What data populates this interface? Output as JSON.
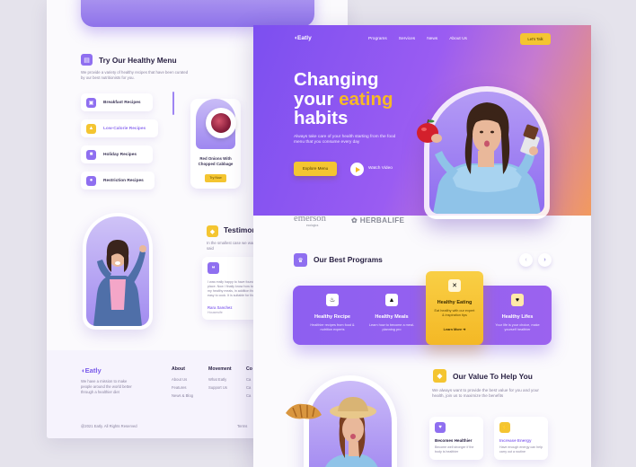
{
  "back_page": {
    "section": {
      "title": "Try Our Healthy Menu",
      "desc": "We provide a variety of healthy recipes that have been curated by our best nutritionists for you."
    },
    "menu": [
      {
        "label": "Breakfast Recipes",
        "icon": "bread-icon"
      },
      {
        "label": "Low-Calorie Recipes",
        "icon": "scale-icon"
      },
      {
        "label": "Holiday Recipes",
        "icon": "gift-icon"
      },
      {
        "label": "Restriction Recipes",
        "icon": "lock-icon"
      }
    ],
    "food_card": {
      "name": "Red Onions With Chopped Cabbage",
      "button": "Try Now"
    },
    "testimonial": {
      "title": "Testimonial",
      "desc": "In the smallest case we want to show what other users have said",
      "text": "I was really happy to have found this place. Now I finally know how to choose my healthy meals, in addition they are easy to cook. It is suitable for the family.",
      "name": "Rara Sanchez",
      "role": "Housewife"
    },
    "footer": {
      "logo": "Eatly",
      "desc": "We have a mission to make people around the world better through a healthier diet",
      "columns": [
        {
          "heading": "About",
          "links": [
            "About Us",
            "Features",
            "News & Blog"
          ]
        },
        {
          "heading": "Movement",
          "links": [
            "What Eatly",
            "Support Us"
          ]
        },
        {
          "heading": "Co",
          "links": [
            "Ca",
            "Ca",
            "Ca"
          ]
        }
      ],
      "copyright": "@2021 Eatly. All Rights Reserved",
      "terms": "Terms"
    }
  },
  "front_page": {
    "nav": {
      "logo": "Eatly",
      "links": [
        "Programs",
        "Services",
        "News",
        "About Us"
      ],
      "cta": "Let's Talk"
    },
    "hero": {
      "title_l1": "Changing",
      "title_l2a": "your ",
      "title_l2b": "eating",
      "title_l3": "habits",
      "desc": "Always take care of your health starting from the food menu that you consume every day",
      "primary_button": "Explore Menu",
      "secondary_button": "Watch Video"
    },
    "partners": {
      "p1": "emerson",
      "p1_sub": "ecologics",
      "p2": "HERBALIFE"
    },
    "programs": {
      "title": "Our Best Programs",
      "items": [
        {
          "title": "Healthy Recipe",
          "desc": "Healthier recipes from food & nutrition experts",
          "icon": "chef-hat-icon"
        },
        {
          "title": "Healthy Meals",
          "desc": "Learn how to become a meal-planning pro",
          "icon": "meal-icon"
        },
        {
          "title": "Healthy Eating",
          "desc": "Eat healthy with our expert & inspiration tips",
          "icon": "utensils-icon",
          "link": "Learn More",
          "highlighted": true
        },
        {
          "title": "Healthy Lifes",
          "desc": "Your life is your choice, make yourself healthier",
          "icon": "heart-shield-icon"
        }
      ]
    },
    "value": {
      "title": "Our Value To Help You",
      "desc": "We always want to provide the best value for you and your health, join us to maximize the benefits",
      "cards": [
        {
          "title": "Becomes Healthier",
          "desc": "Become well stronger if the body is healthier",
          "color": "#8f6ff0"
        },
        {
          "title": "Increase Energy",
          "desc": "Have enough energy can help carry out a routine",
          "color": "#f4c531"
        }
      ]
    }
  },
  "colors": {
    "accent": "#8f6ff0",
    "yellow": "#f4c531",
    "dark_text": "#2a2244"
  }
}
